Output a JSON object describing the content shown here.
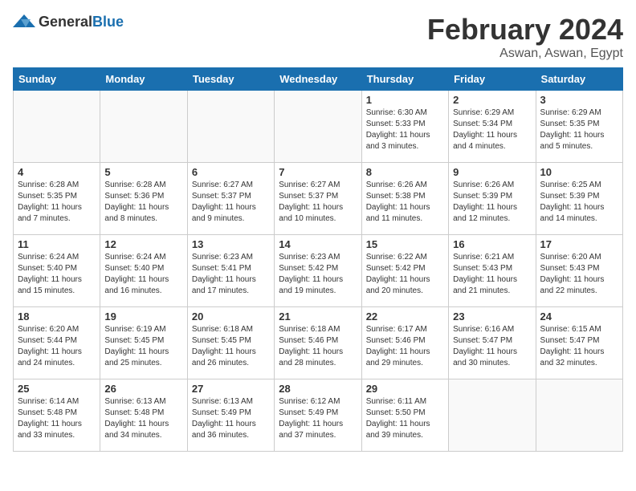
{
  "header": {
    "logo_general": "General",
    "logo_blue": "Blue",
    "month_year": "February 2024",
    "location": "Aswan, Aswan, Egypt"
  },
  "days_of_week": [
    "Sunday",
    "Monday",
    "Tuesday",
    "Wednesday",
    "Thursday",
    "Friday",
    "Saturday"
  ],
  "weeks": [
    [
      {
        "day": "",
        "info": ""
      },
      {
        "day": "",
        "info": ""
      },
      {
        "day": "",
        "info": ""
      },
      {
        "day": "",
        "info": ""
      },
      {
        "day": "1",
        "info": "Sunrise: 6:30 AM\nSunset: 5:33 PM\nDaylight: 11 hours and 3 minutes."
      },
      {
        "day": "2",
        "info": "Sunrise: 6:29 AM\nSunset: 5:34 PM\nDaylight: 11 hours and 4 minutes."
      },
      {
        "day": "3",
        "info": "Sunrise: 6:29 AM\nSunset: 5:35 PM\nDaylight: 11 hours and 5 minutes."
      }
    ],
    [
      {
        "day": "4",
        "info": "Sunrise: 6:28 AM\nSunset: 5:35 PM\nDaylight: 11 hours and 7 minutes."
      },
      {
        "day": "5",
        "info": "Sunrise: 6:28 AM\nSunset: 5:36 PM\nDaylight: 11 hours and 8 minutes."
      },
      {
        "day": "6",
        "info": "Sunrise: 6:27 AM\nSunset: 5:37 PM\nDaylight: 11 hours and 9 minutes."
      },
      {
        "day": "7",
        "info": "Sunrise: 6:27 AM\nSunset: 5:37 PM\nDaylight: 11 hours and 10 minutes."
      },
      {
        "day": "8",
        "info": "Sunrise: 6:26 AM\nSunset: 5:38 PM\nDaylight: 11 hours and 11 minutes."
      },
      {
        "day": "9",
        "info": "Sunrise: 6:26 AM\nSunset: 5:39 PM\nDaylight: 11 hours and 12 minutes."
      },
      {
        "day": "10",
        "info": "Sunrise: 6:25 AM\nSunset: 5:39 PM\nDaylight: 11 hours and 14 minutes."
      }
    ],
    [
      {
        "day": "11",
        "info": "Sunrise: 6:24 AM\nSunset: 5:40 PM\nDaylight: 11 hours and 15 minutes."
      },
      {
        "day": "12",
        "info": "Sunrise: 6:24 AM\nSunset: 5:40 PM\nDaylight: 11 hours and 16 minutes."
      },
      {
        "day": "13",
        "info": "Sunrise: 6:23 AM\nSunset: 5:41 PM\nDaylight: 11 hours and 17 minutes."
      },
      {
        "day": "14",
        "info": "Sunrise: 6:23 AM\nSunset: 5:42 PM\nDaylight: 11 hours and 19 minutes."
      },
      {
        "day": "15",
        "info": "Sunrise: 6:22 AM\nSunset: 5:42 PM\nDaylight: 11 hours and 20 minutes."
      },
      {
        "day": "16",
        "info": "Sunrise: 6:21 AM\nSunset: 5:43 PM\nDaylight: 11 hours and 21 minutes."
      },
      {
        "day": "17",
        "info": "Sunrise: 6:20 AM\nSunset: 5:43 PM\nDaylight: 11 hours and 22 minutes."
      }
    ],
    [
      {
        "day": "18",
        "info": "Sunrise: 6:20 AM\nSunset: 5:44 PM\nDaylight: 11 hours and 24 minutes."
      },
      {
        "day": "19",
        "info": "Sunrise: 6:19 AM\nSunset: 5:45 PM\nDaylight: 11 hours and 25 minutes."
      },
      {
        "day": "20",
        "info": "Sunrise: 6:18 AM\nSunset: 5:45 PM\nDaylight: 11 hours and 26 minutes."
      },
      {
        "day": "21",
        "info": "Sunrise: 6:18 AM\nSunset: 5:46 PM\nDaylight: 11 hours and 28 minutes."
      },
      {
        "day": "22",
        "info": "Sunrise: 6:17 AM\nSunset: 5:46 PM\nDaylight: 11 hours and 29 minutes."
      },
      {
        "day": "23",
        "info": "Sunrise: 6:16 AM\nSunset: 5:47 PM\nDaylight: 11 hours and 30 minutes."
      },
      {
        "day": "24",
        "info": "Sunrise: 6:15 AM\nSunset: 5:47 PM\nDaylight: 11 hours and 32 minutes."
      }
    ],
    [
      {
        "day": "25",
        "info": "Sunrise: 6:14 AM\nSunset: 5:48 PM\nDaylight: 11 hours and 33 minutes."
      },
      {
        "day": "26",
        "info": "Sunrise: 6:13 AM\nSunset: 5:48 PM\nDaylight: 11 hours and 34 minutes."
      },
      {
        "day": "27",
        "info": "Sunrise: 6:13 AM\nSunset: 5:49 PM\nDaylight: 11 hours and 36 minutes."
      },
      {
        "day": "28",
        "info": "Sunrise: 6:12 AM\nSunset: 5:49 PM\nDaylight: 11 hours and 37 minutes."
      },
      {
        "day": "29",
        "info": "Sunrise: 6:11 AM\nSunset: 5:50 PM\nDaylight: 11 hours and 39 minutes."
      },
      {
        "day": "",
        "info": ""
      },
      {
        "day": "",
        "info": ""
      }
    ]
  ]
}
